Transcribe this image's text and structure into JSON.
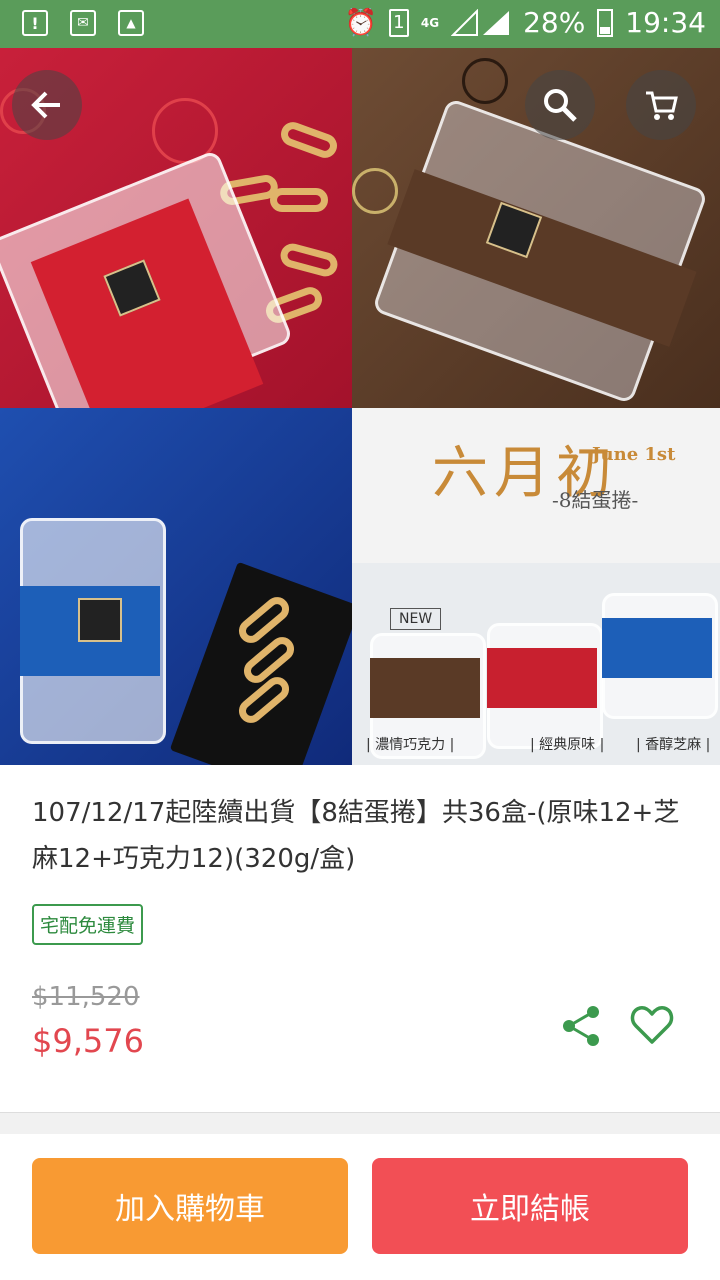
{
  "status_bar": {
    "battery": "28%",
    "time": "19:34",
    "network": "4G",
    "sim": "1",
    "icons": [
      "alert-icon",
      "mail-icon",
      "image-icon",
      "alarm-icon",
      "sim-icon",
      "signal-icon",
      "battery-icon"
    ]
  },
  "nav": {
    "icons": [
      "arrow-left-icon",
      "search-icon",
      "cart-icon"
    ]
  },
  "hero": {
    "brand_name": "六月初",
    "brand_en": "June 1st",
    "product_sub": "-8結蛋捲-",
    "new_tag": "NEW",
    "flavors": [
      "| 濃情巧克力 |",
      "| 經典原味 |",
      "| 香醇芝麻 |"
    ]
  },
  "product": {
    "title": "107/12/17起陸續出貨【8結蛋捲】共36盒-(原味12+芝麻12+巧克力12)(320g/盒)",
    "shipping_badge": "宅配免運費",
    "original_price": "$11,520",
    "sale_price": "$9,576"
  },
  "actions": {
    "add_to_cart": "加入購物車",
    "checkout": "立即結帳"
  },
  "colors": {
    "status_bar": "#5a9c5a",
    "accent_green": "#3c9a4e",
    "price_red": "#e2474f",
    "cart_orange": "#f89a33",
    "checkout_red": "#f24f55"
  }
}
